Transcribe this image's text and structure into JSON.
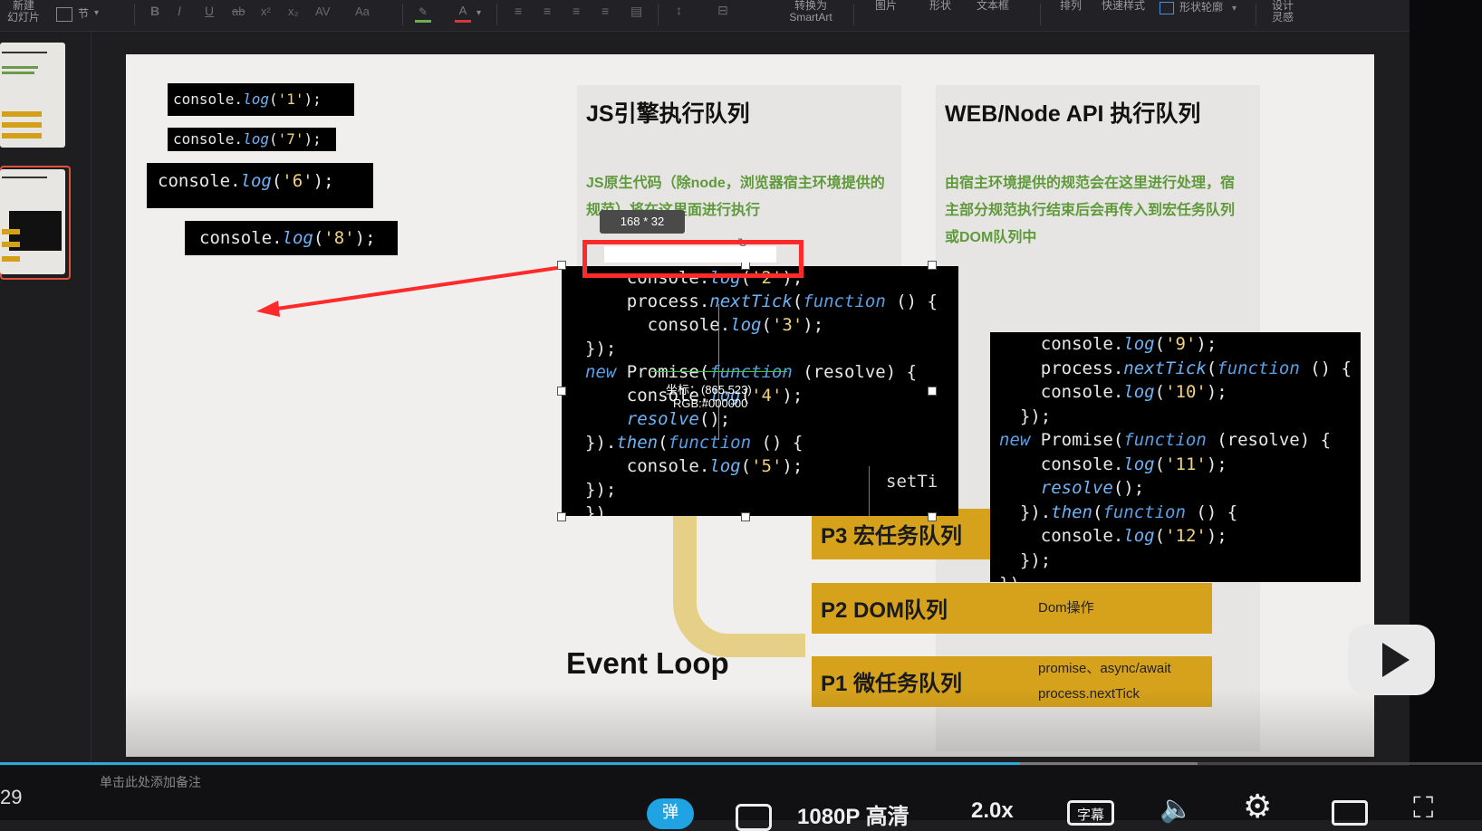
{
  "ribbon": {
    "new_slide": "新建\n幻灯片",
    "section": "节",
    "convert_smartart": "转换为\nSmartArt",
    "picture": "图片",
    "shape": "形状",
    "textbox": "文本框",
    "arrange": "排列",
    "quick_style": "快速样式",
    "shape_outline": "形状轮廓",
    "design_ideas": "设计\n灵感"
  },
  "slide": {
    "js_engine_title": "JS引擎执行队列",
    "js_engine_desc": "JS原生代码（除node，浏览器宿主环境提供的规范）将在这里面进行执行",
    "web_api_title": "WEB/Node API 执行队列",
    "web_api_desc": "由宿主环境提供的规范会在这里进行处理，宿主部分规范执行结束后会再传入到宏任务队列或DOM队列中",
    "event_loop": "Event Loop",
    "queues": [
      {
        "label": "P3 宏任务队列",
        "desc": ""
      },
      {
        "label": "P2 DOM队列",
        "desc": "Dom操作"
      },
      {
        "label": "P1 微任务队列",
        "desc": "promise、async/await\nprocess.nextTick"
      }
    ],
    "set_timeout_fragment": "setTi",
    "log_1": "'1'",
    "log_7": "'7'",
    "log_6": "'6'",
    "log_8": "'8'",
    "log_2": "'2'"
  },
  "overlay": {
    "size_label": "168 * 32",
    "coords": "坐标：(865,523)",
    "rgb": "RGB:#000000"
  },
  "notes": {
    "placeholder": "单击此处添加备注",
    "slide_number": "29"
  },
  "player": {
    "danmaku": "弹",
    "quality": "1080P 高清",
    "speed": "2.0x",
    "subtitle": "字幕"
  },
  "progress": {
    "played_fraction": 0.688
  },
  "colors": {
    "accent": "#2fa8e0",
    "queue": "#d6a21c",
    "green_text": "#5f9a3a",
    "annotation": "#ff2a2a"
  }
}
